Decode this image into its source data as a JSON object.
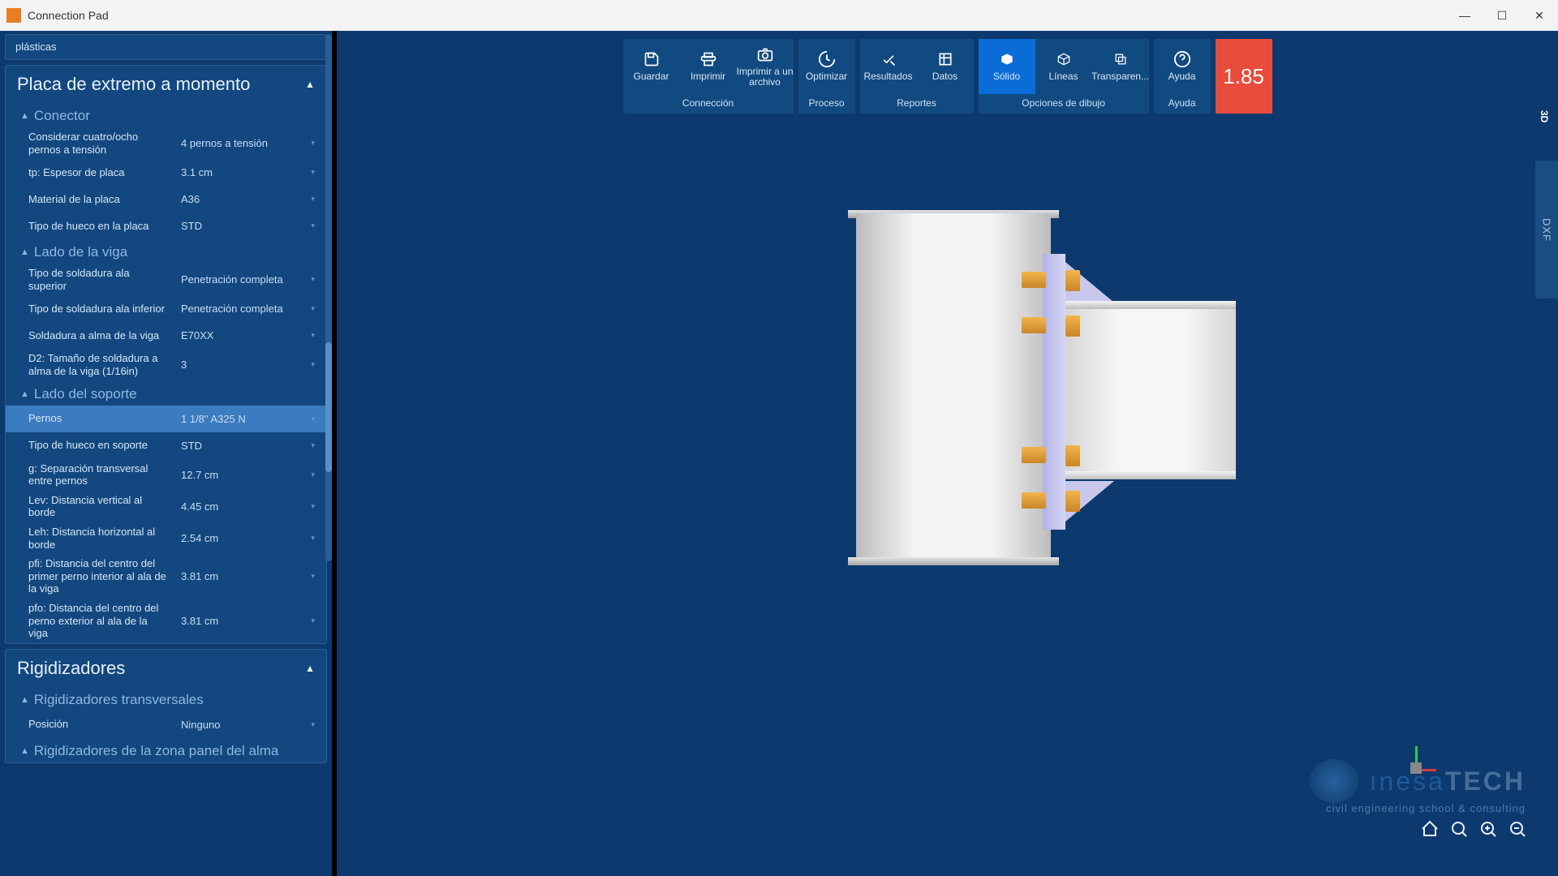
{
  "titlebar": {
    "app_title": "Connection Pad"
  },
  "ribbon": {
    "groups": [
      {
        "label": "Connección",
        "buttons": [
          {
            "icon": "save-icon",
            "label": "Guardar"
          },
          {
            "icon": "print-icon",
            "label": "Imprimir"
          },
          {
            "icon": "camera-icon",
            "label": "Imprimir a un archivo"
          }
        ]
      },
      {
        "label": "Proceso",
        "buttons": [
          {
            "icon": "optimize-icon",
            "label": "Optimizar"
          }
        ]
      },
      {
        "label": "Reportes",
        "buttons": [
          {
            "icon": "results-icon",
            "label": "Resultados"
          },
          {
            "icon": "data-icon",
            "label": "Datos"
          }
        ]
      },
      {
        "label": "Opciones de dibujo",
        "buttons": [
          {
            "icon": "solid-icon",
            "label": "Sólido",
            "active": true
          },
          {
            "icon": "lines-icon",
            "label": "Líneas"
          },
          {
            "icon": "transparent-icon",
            "label": "Transparen..."
          }
        ]
      },
      {
        "label": "Ayuda",
        "buttons": [
          {
            "icon": "help-icon",
            "label": "Ayuda"
          }
        ]
      }
    ],
    "score": "1.85"
  },
  "side_tabs": {
    "threeD": "3D",
    "dxf": "DXF"
  },
  "panel": {
    "top_frag": "plásticas",
    "section1": {
      "title": "Placa de extremo a momento",
      "group1": {
        "title": "Conector",
        "rows": [
          {
            "label": "Considerar cuatro/ocho pernos a tensión",
            "value": "4 pernos a tensión"
          },
          {
            "label": "tp:  Espesor de placa",
            "value": "3.1 cm"
          },
          {
            "label": "Material de la placa",
            "value": "A36"
          },
          {
            "label": "Tipo de hueco en la placa",
            "value": "STD"
          }
        ]
      },
      "group2": {
        "title": "Lado de la viga",
        "rows": [
          {
            "label": "Tipo de soldadura ala superior",
            "value": "Penetración completa"
          },
          {
            "label": "Tipo de soldadura ala inferior",
            "value": "Penetración completa"
          },
          {
            "label": "Soldadura a alma de la viga",
            "value": "E70XX"
          },
          {
            "label": "D2:  Tamaño de soldadura a alma de la viga (1/16in)",
            "value": "3"
          }
        ]
      },
      "group3": {
        "title": "Lado del soporte",
        "rows": [
          {
            "label": "Pernos",
            "value": "1 1/8\" A325 N",
            "selected": true
          },
          {
            "label": "Tipo de hueco en soporte",
            "value": "STD"
          },
          {
            "label": "g:  Separación transversal entre pernos",
            "value": "12.7 cm"
          },
          {
            "label": "Lev:  Distancia vertical al borde",
            "value": "4.45 cm"
          },
          {
            "label": "Leh:  Distancia horizontal al borde",
            "value": "2.54 cm"
          },
          {
            "label": "pfi: Distancia del centro del primer perno interior al ala de la viga",
            "value": "3.81 cm"
          },
          {
            "label": "pfo: Distancia del centro del perno exterior al ala de la viga",
            "value": "3.81 cm"
          }
        ]
      }
    },
    "section2": {
      "title": "Rigidizadores",
      "group1": {
        "title": "Rigidizadores transversales",
        "rows": [
          {
            "label": "Posición",
            "value": "Ninguno"
          }
        ]
      },
      "group2": {
        "title": "Rigidizadores de la zona panel del alma"
      }
    }
  },
  "toolbar_icons": {
    "home": "⌂",
    "zoom_in": "+",
    "zoom_out": "−",
    "fit": "⛶"
  },
  "logo": {
    "brand": "ınesa",
    "tech": "TECH",
    "tag": "civil engineering school & consulting"
  }
}
